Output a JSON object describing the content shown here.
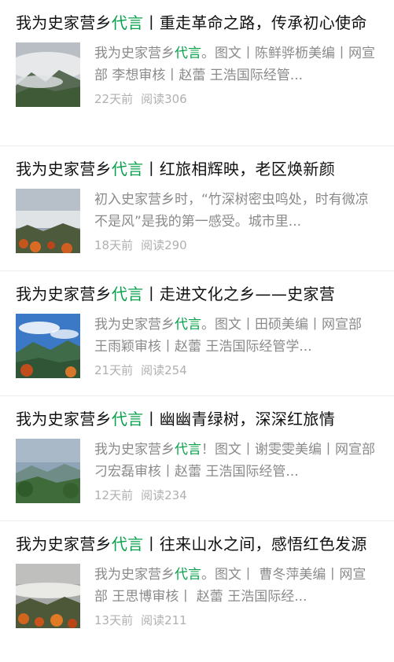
{
  "articles": [
    {
      "title_prefix": "我为史家营乡",
      "title_accent": "代言",
      "title_rest": "丨重走革命之路，传承初心使命",
      "summary_prefix": "我为史家营乡",
      "summary_accent": "代言",
      "summary_rest": "。图文丨陈鲜骅枥美编丨网宣部 李想审核丨赵蕾 王浩国际经管...",
      "time": "22天前",
      "reads": "阅读306",
      "thumb_icon": "mountain-fog-photo"
    },
    {
      "title_prefix": "我为史家营乡",
      "title_accent": "代言",
      "title_rest": "丨红旅相辉映，老区焕新颜",
      "summary_prefix": "初入史家营乡时，“竹深树密虫鸣处，时有微凉不是风”是我的第一感受。城市里...",
      "summary_accent": "",
      "summary_rest": "",
      "time": "18天前",
      "reads": "阅读290",
      "thumb_icon": "sea-of-clouds-photo"
    },
    {
      "title_prefix": "我为史家营乡",
      "title_accent": "代言",
      "title_rest": "丨走进文化之乡——史家营",
      "summary_prefix": "我为史家营乡",
      "summary_accent": "代言",
      "summary_rest": "。图文丨田硕美编丨网宣部 王雨颖审核丨赵蕾 王浩国际经管学...",
      "time": "21天前",
      "reads": "阅读254",
      "thumb_icon": "blue-sky-mountain-photo"
    },
    {
      "title_prefix": "我为史家营乡",
      "title_accent": "代言",
      "title_rest": "丨幽幽青绿树，深深红旅情",
      "summary_prefix": "我为史家营乡",
      "summary_accent": "代言",
      "summary_rest": "！图文丨谢雯雯美编丨网宣部 刁宏磊审核丨赵蕾 王浩国际经管...",
      "time": "12天前",
      "reads": "阅读234",
      "thumb_icon": "green-valley-photo"
    },
    {
      "title_prefix": "我为史家营乡",
      "title_accent": "代言",
      "title_rest": "丨往来山水之间，感悟红色发源",
      "summary_prefix": "我为史家营乡",
      "summary_accent": "代言",
      "summary_rest": "。图文丨 曹冬萍美编丨网宣部 王思博审核丨 赵蕾 王浩国际经...",
      "time": "13天前",
      "reads": "阅读211",
      "thumb_icon": "clouds-sunset-photo"
    }
  ],
  "colors": {
    "accent": "#07a14a",
    "meta": "#b0b0b0",
    "summary": "#8a8a8a"
  }
}
